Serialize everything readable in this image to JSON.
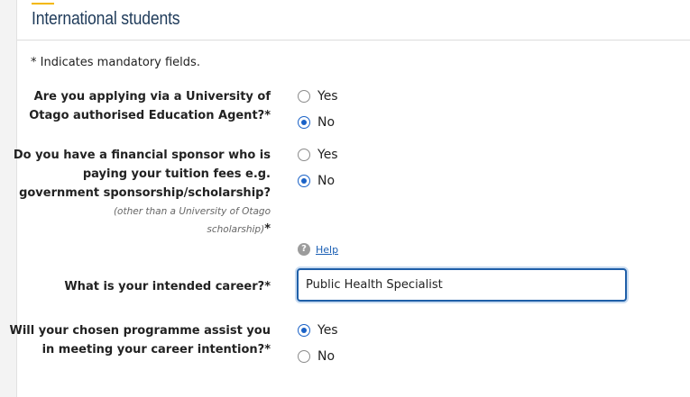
{
  "section": {
    "title": "International students"
  },
  "mandatory_note": "* Indicates mandatory fields.",
  "questions": {
    "agent": {
      "label_line1": "Are you applying via a University of",
      "label_line2": "Otago authorised Education Agent?*",
      "options": [
        "Yes",
        "No"
      ],
      "selected": "No"
    },
    "sponsor": {
      "label_line1": "Do you have a financial sponsor who is",
      "label_line2": "paying your tuition fees e.g.",
      "label_line3": "government sponsorship/scholarship?",
      "sub_line1": "(other than a University of Otago",
      "sub_line2": "scholarship)",
      "sub_star": "*",
      "options": [
        "Yes",
        "No"
      ],
      "selected": "No",
      "help_label": "Help"
    },
    "career": {
      "label": "What is your intended career?*",
      "value": "Public Health Specialist"
    },
    "programme": {
      "label_line1": "Will your chosen programme assist you",
      "label_line2": "in meeting your career intention?*",
      "options": [
        "Yes",
        "No"
      ],
      "selected": "Yes"
    }
  },
  "colors": {
    "accent": "#f3b800",
    "title": "#1f3b5a",
    "focus": "#1f5fa8",
    "radio_checked": "#1a62c7"
  }
}
